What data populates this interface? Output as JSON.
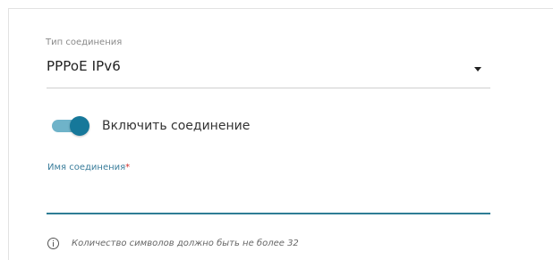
{
  "connection_type": {
    "label": "Тип соединения",
    "value": "PPPoE IPv6",
    "icon": "chevron-down-icon"
  },
  "enable_connection": {
    "label": "Включить соединение",
    "checked": true,
    "track_color": "#6fb3c9",
    "knob_color": "#16789a"
  },
  "connection_name": {
    "label": "Имя соединения",
    "required_mark": "*",
    "value": "",
    "accent_color": "#2e7d95"
  },
  "hint": {
    "icon": "info-icon",
    "text": "Количество символов должно быть не более 32"
  }
}
